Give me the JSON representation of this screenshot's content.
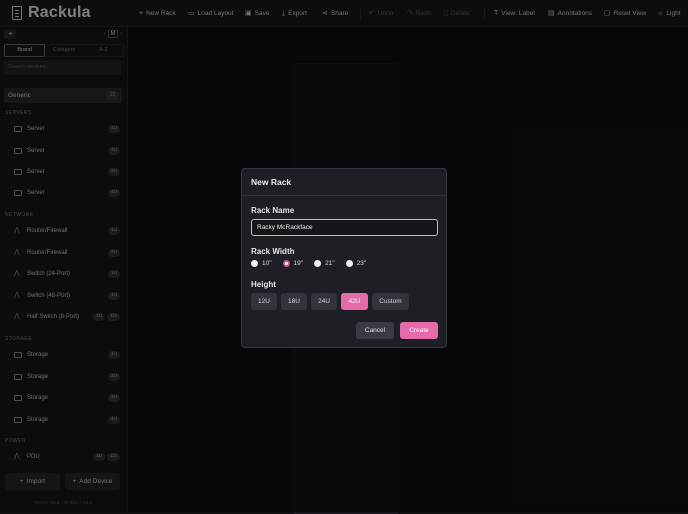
{
  "app": {
    "title": "Rackula"
  },
  "toolbar": {
    "new_rack": "New Rack",
    "load_layout": "Load Layout",
    "save": "Save",
    "export": "Export",
    "share": "Share",
    "undo": "Undo",
    "redo": "Redo",
    "delete": "Delete",
    "view": "View: Label",
    "annotations": "Annotations",
    "reset_view": "Reset View",
    "theme": "Light"
  },
  "sidebar": {
    "hide": "◂",
    "pager": {
      "prev": "‹",
      "current": "M",
      "next": "›"
    },
    "tabs": [
      "Brand",
      "Category",
      "A-Z"
    ],
    "search_placeholder": "Search devices...",
    "generic": {
      "label": "Generic",
      "count": "12"
    },
    "categories": [
      {
        "name": "SERVERS",
        "items": [
          {
            "name": "Server",
            "badges": [
              "1U"
            ]
          },
          {
            "name": "Server",
            "badges": [
              "2U"
            ]
          },
          {
            "name": "Server",
            "badges": [
              "3U"
            ]
          },
          {
            "name": "Server",
            "badges": [
              "4U"
            ]
          }
        ]
      },
      {
        "name": "NETWORK",
        "items": [
          {
            "name": "Router/Firewall",
            "badges": [
              "1U"
            ]
          },
          {
            "name": "Router/Firewall",
            "badges": [
              "2U"
            ]
          },
          {
            "name": "Switch (24-Port)",
            "badges": [
              "1U"
            ]
          },
          {
            "name": "Switch (48-Port)",
            "badges": [
              "1U"
            ]
          },
          {
            "name": "Half Switch (8-Port)",
            "badges": [
              "1U",
              "1/2"
            ]
          }
        ]
      },
      {
        "name": "STORAGE",
        "items": [
          {
            "name": "Storage",
            "badges": [
              "1U"
            ]
          },
          {
            "name": "Storage",
            "badges": [
              "2U"
            ]
          },
          {
            "name": "Storage",
            "badges": [
              "3U"
            ]
          },
          {
            "name": "Storage",
            "badges": [
              "4U"
            ]
          }
        ]
      },
      {
        "name": "POWER",
        "items": [
          {
            "name": "PDU",
            "badges": [
              "1U",
              "1/2"
            ]
          }
        ]
      }
    ],
    "import": "Import",
    "add_device": "Add Device",
    "footer": "Report Issue | NetBox | 0.6.6"
  },
  "modal": {
    "title": "New Rack",
    "name_label": "Rack Name",
    "name_value": "Racky McRackface",
    "width_label": "Rack Width",
    "widths": [
      "10\"",
      "19\"",
      "21\"",
      "23\""
    ],
    "selected_width": "19\"",
    "height_label": "Height",
    "heights": [
      "12U",
      "18U",
      "24U",
      "42U",
      "Custom"
    ],
    "selected_height": "42U",
    "cancel": "Cancel",
    "create": "Create"
  },
  "colors": {
    "accent": "#e56aaa",
    "background": "#0e0e13",
    "panel": "#1e1e25"
  }
}
